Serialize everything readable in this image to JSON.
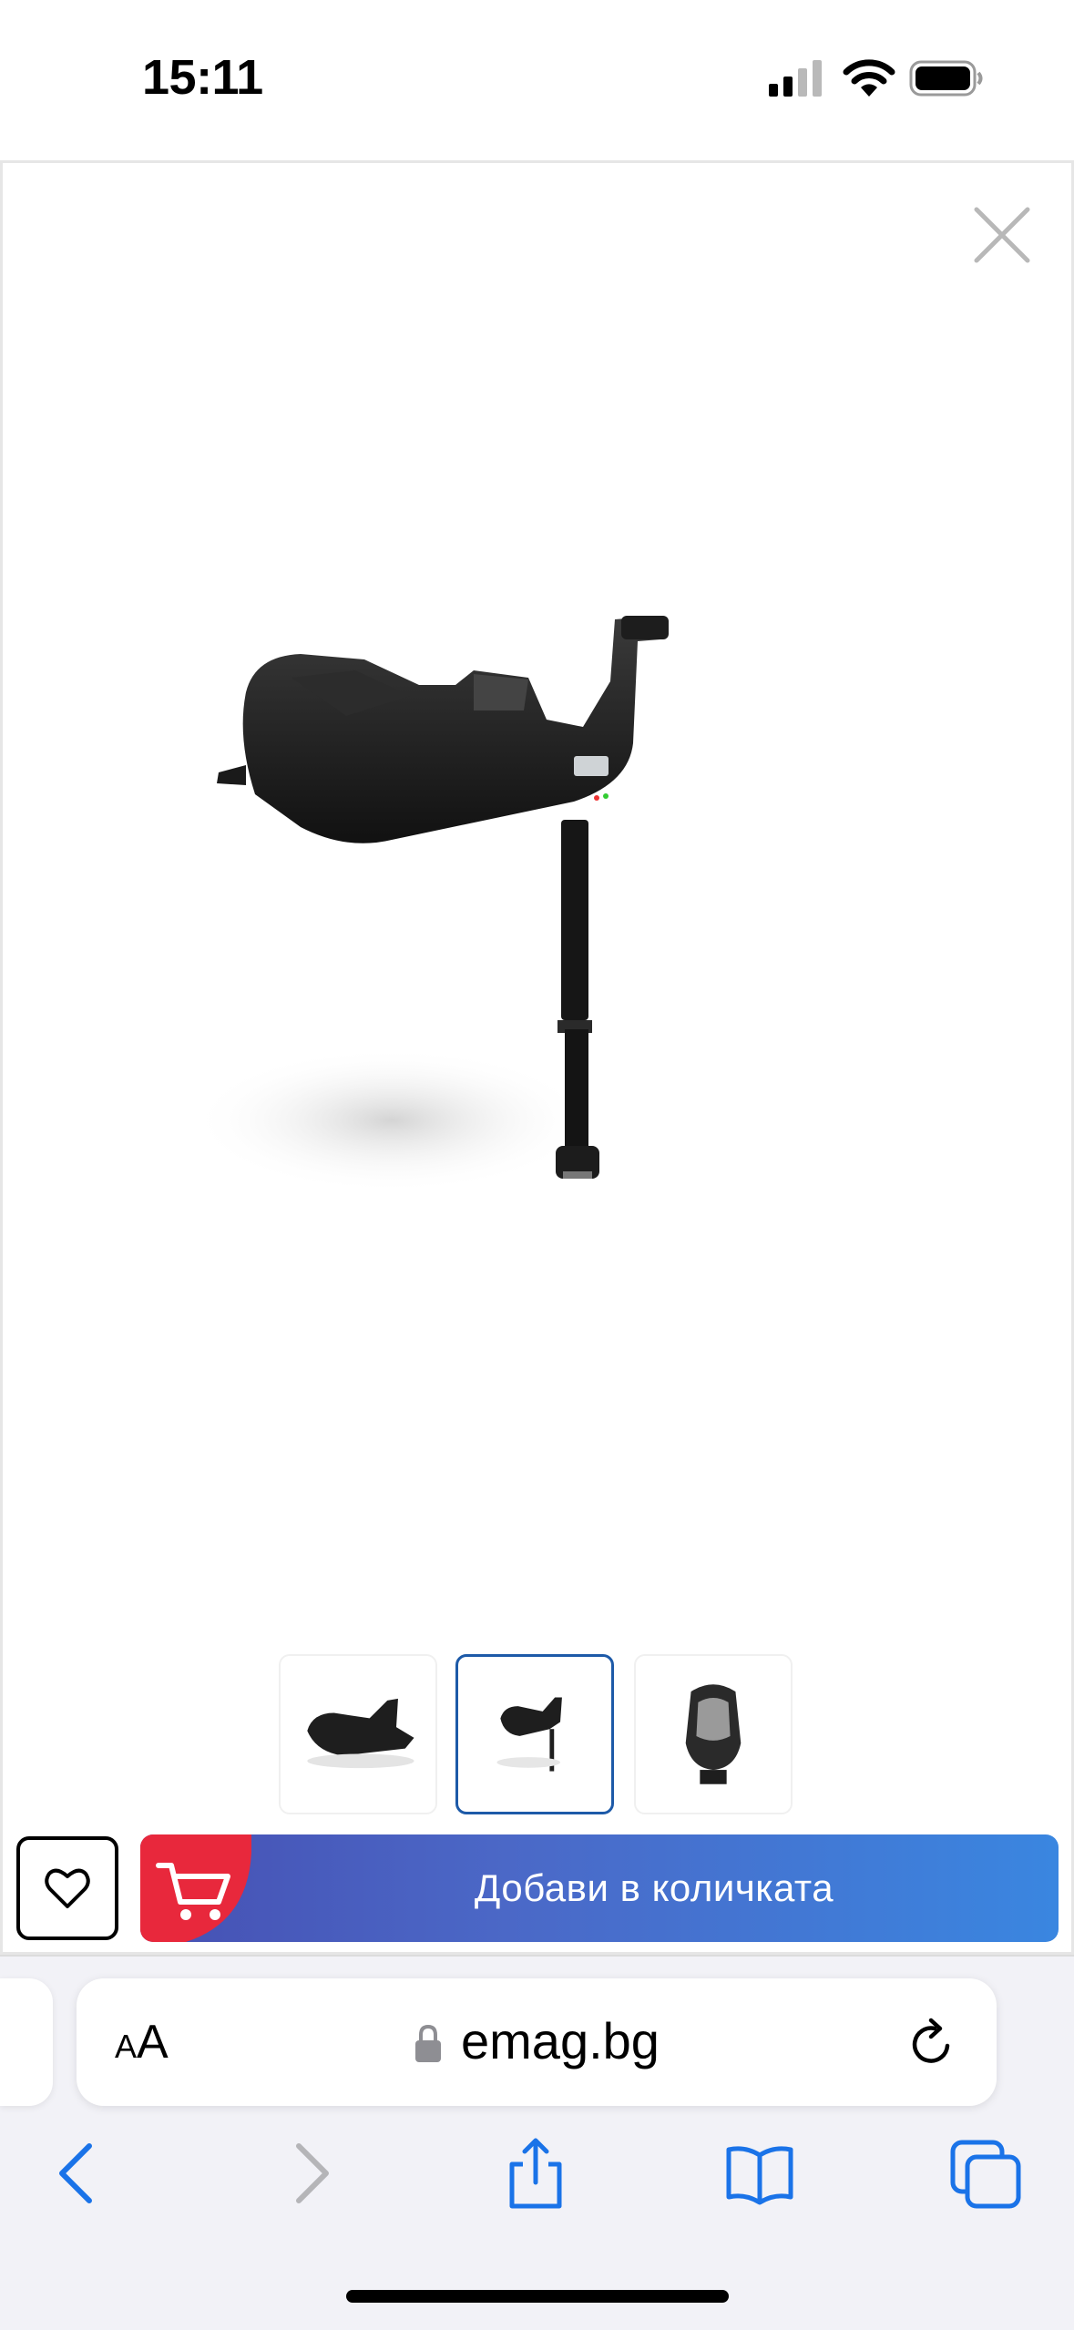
{
  "status_bar": {
    "time": "15:11",
    "signal_icon": "cellular-signal-icon",
    "wifi_icon": "wifi-icon",
    "battery_icon": "battery-icon"
  },
  "gallery": {
    "close_icon": "close-icon",
    "main_image": "car-seat-isofix-base-image",
    "thumbnails": [
      {
        "image": "isofix-base-thumbnail",
        "selected": false
      },
      {
        "image": "isofix-base-with-leg-thumbnail",
        "selected": true
      },
      {
        "image": "car-seat-on-base-thumbnail",
        "selected": false
      }
    ]
  },
  "actions": {
    "favorite_icon": "heart-icon",
    "cart_icon": "cart-icon",
    "add_to_cart_label": "Добави в количката",
    "accent_color": "#e8283c",
    "button_color": "#4b68c7"
  },
  "browser": {
    "text_size_small": "A",
    "text_size_large": "A",
    "url": "emag.bg",
    "lock_icon": "lock-icon",
    "reload_icon": "reload-icon",
    "toolbar": [
      "back-icon",
      "forward-icon",
      "share-icon",
      "bookmarks-icon",
      "tabs-icon"
    ]
  }
}
